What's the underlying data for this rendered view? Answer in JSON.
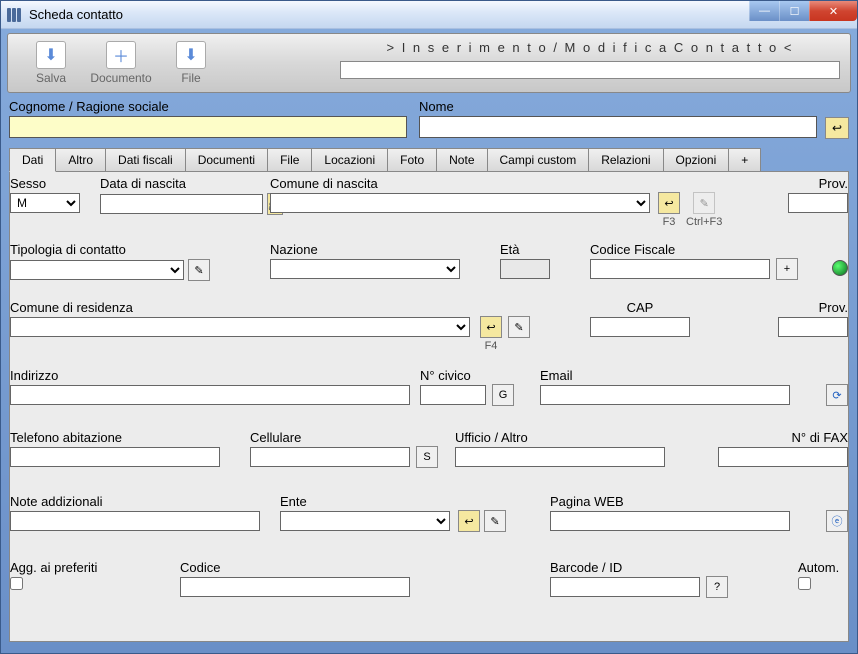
{
  "window": {
    "title": "Scheda contatto"
  },
  "toolbar": {
    "salva": "Salva",
    "documento": "Documento",
    "file": "File",
    "mode": "> I n s e r i m e n t o   /   M o d i f i c a    C o n t a t t o <"
  },
  "header": {
    "cognome_label": "Cognome / Ragione sociale",
    "cognome_value": "",
    "nome_label": "Nome",
    "nome_value": ""
  },
  "tabs": [
    "Dati",
    "Altro",
    "Dati fiscali",
    "Documenti",
    "File",
    "Locazioni",
    "Foto",
    "Note",
    "Campi custom",
    "Relazioni",
    "Opzioni",
    "+"
  ],
  "active_tab": 0,
  "fields": {
    "sesso": {
      "label": "Sesso",
      "value": "M"
    },
    "data_nascita": {
      "label": "Data di nascita",
      "value": ""
    },
    "comune_nascita": {
      "label": "Comune di nascita",
      "value": "",
      "hotkey1": "F3",
      "hotkey2": "Ctrl+F3"
    },
    "prov1": {
      "label": "Prov.",
      "value": ""
    },
    "tipologia": {
      "label": "Tipologia di contatto",
      "value": ""
    },
    "nazione": {
      "label": "Nazione",
      "value": ""
    },
    "eta": {
      "label": "Età",
      "value": ""
    },
    "codfisc": {
      "label": "Codice Fiscale",
      "value": ""
    },
    "comune_res": {
      "label": "Comune di residenza",
      "value": "",
      "hotkey": "F4"
    },
    "cap": {
      "label": "CAP",
      "value": ""
    },
    "prov2": {
      "label": "Prov.",
      "value": ""
    },
    "indirizzo": {
      "label": "Indirizzo",
      "value": ""
    },
    "civico": {
      "label": "N° civico",
      "value": "",
      "btn": "G"
    },
    "email": {
      "label": "Email",
      "value": ""
    },
    "tel_ab": {
      "label": "Telefono abitazione",
      "value": ""
    },
    "cell": {
      "label": "Cellulare",
      "value": "",
      "btn": "S"
    },
    "ufficio": {
      "label": "Ufficio / Altro",
      "value": ""
    },
    "fax": {
      "label": "N° di FAX",
      "value": ""
    },
    "note": {
      "label": "Note addizionali",
      "value": ""
    },
    "ente": {
      "label": "Ente",
      "value": ""
    },
    "web": {
      "label": "Pagina WEB",
      "value": ""
    },
    "pref": {
      "label": "Agg. ai preferiti"
    },
    "codice": {
      "label": "Codice",
      "value": ""
    },
    "barcode": {
      "label": "Barcode / ID",
      "value": "",
      "btn": "?"
    },
    "autom": {
      "label": "Autom."
    }
  }
}
